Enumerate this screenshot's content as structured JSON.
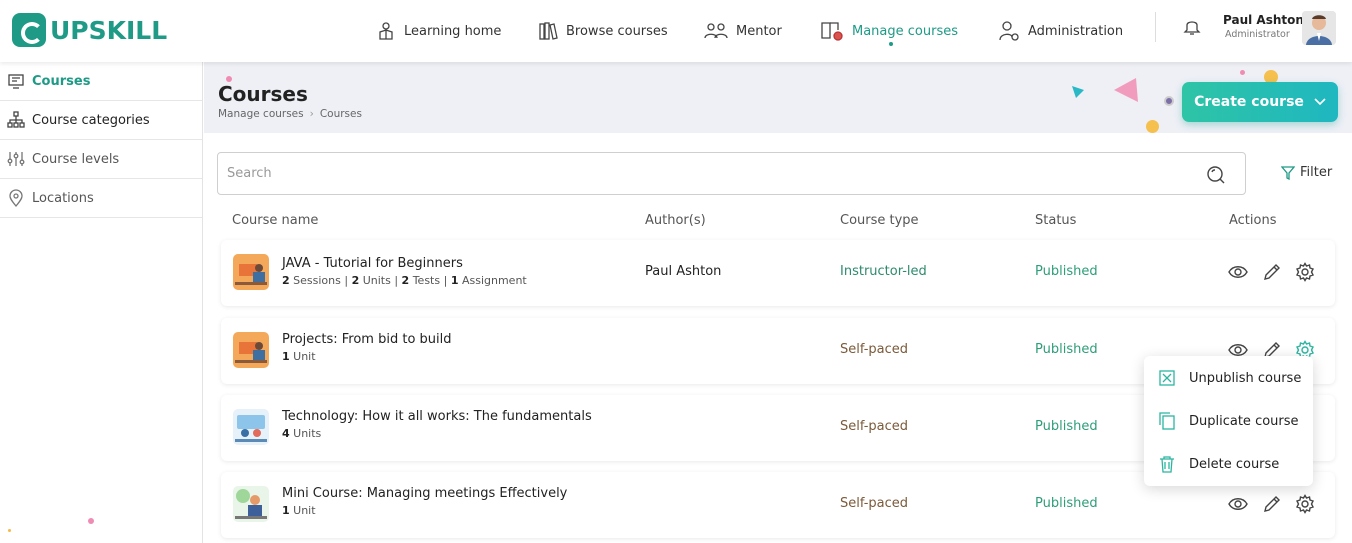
{
  "brand": {
    "name": "UPSKILL",
    "color": "#1e9a86"
  },
  "nav": [
    {
      "label": "Learning home",
      "icon": "learning-home-icon"
    },
    {
      "label": "Browse courses",
      "icon": "books-icon"
    },
    {
      "label": "Mentor",
      "icon": "mentor-icon"
    },
    {
      "label": "Manage courses",
      "icon": "manage-courses-icon",
      "active": true
    },
    {
      "label": "Administration",
      "icon": "admin-user-gear-icon"
    }
  ],
  "user": {
    "name": "Paul Ashton",
    "role": "Administrator"
  },
  "sidebar": {
    "items": [
      {
        "label": "Courses",
        "icon": "monitor-icon",
        "active": true
      },
      {
        "label": "Course categories",
        "icon": "hierarchy-icon"
      },
      {
        "label": "Course levels",
        "icon": "sliders-icon"
      },
      {
        "label": "Locations",
        "icon": "location-pin-icon"
      }
    ]
  },
  "page": {
    "title": "Courses",
    "breadcrumb": [
      "Manage courses",
      "Courses"
    ],
    "create_label": "Create course"
  },
  "search": {
    "placeholder": "Search",
    "value": ""
  },
  "filter_label": "Filter",
  "table": {
    "headers": [
      "Course name",
      "Author(s)",
      "Course type",
      "Status",
      "Actions"
    ],
    "rows": [
      {
        "title": "JAVA - Tutorial for Beginners",
        "meta": [
          [
            "2",
            "Sessions"
          ],
          [
            "2",
            "Units"
          ],
          [
            "2",
            "Tests"
          ],
          [
            "1",
            "Assignment"
          ]
        ],
        "author": "Paul Ashton",
        "type": "Instructor-led",
        "status": "Published"
      },
      {
        "title": "Projects: From bid to build",
        "meta": [
          [
            "1",
            "Unit"
          ]
        ],
        "author": "",
        "type": "Self-paced",
        "status": "Published"
      },
      {
        "title": "Technology: How it all works: The fundamentals",
        "meta": [
          [
            "4",
            "Units"
          ]
        ],
        "author": "",
        "type": "Self-paced",
        "status": "Published"
      },
      {
        "title": "Mini Course: Managing meetings Effectively",
        "meta": [
          [
            "1",
            "Unit"
          ]
        ],
        "author": "",
        "type": "Self-paced",
        "status": "Published"
      }
    ]
  },
  "menu": {
    "items": [
      {
        "label": "Unpublish course",
        "icon": "unpublish-icon"
      },
      {
        "label": "Duplicate course",
        "icon": "duplicate-icon"
      },
      {
        "label": "Delete course",
        "icon": "trash-icon"
      }
    ]
  },
  "colors": {
    "accent": "#1e9a86",
    "instructor_led": "#2e8a6e",
    "self_paced": "#7a5a3a",
    "published": "#2e9d7a"
  }
}
